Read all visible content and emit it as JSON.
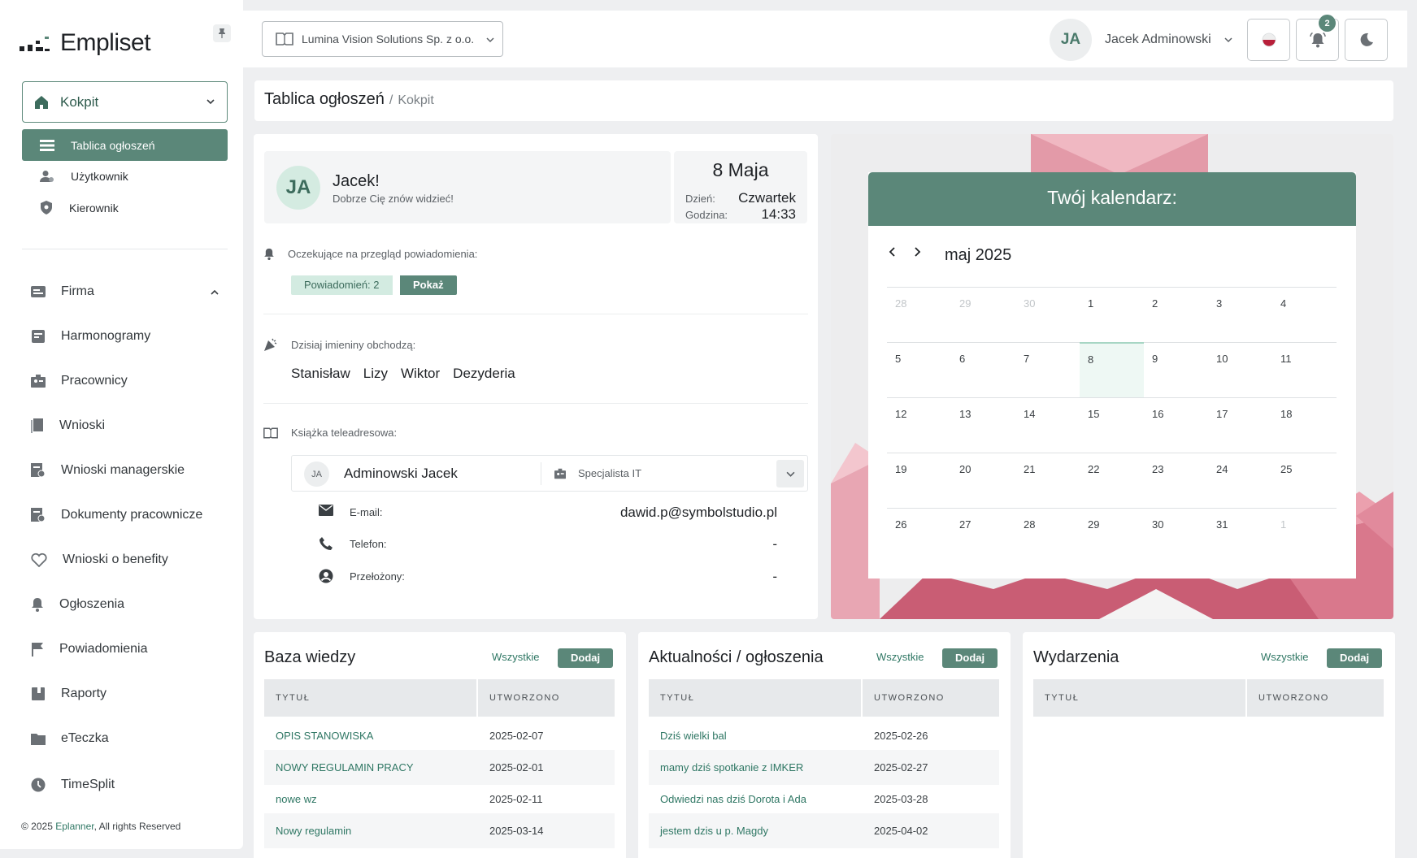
{
  "brand": {
    "name": "Empliset"
  },
  "sidebar": {
    "main_menu": {
      "label": "Kokpit"
    },
    "sub_items": [
      {
        "label": "Tablica ogłoszeń",
        "icon": "list-icon",
        "active": true
      },
      {
        "label": "Użytkownik",
        "icon": "user-icon",
        "active": false
      },
      {
        "label": "Kierownik",
        "icon": "shield-icon",
        "active": false
      }
    ],
    "nav_items": [
      {
        "label": "Firma",
        "icon": "company-icon",
        "expandable": true
      },
      {
        "label": "Harmonogramy",
        "icon": "schedule-icon"
      },
      {
        "label": "Pracownicy",
        "icon": "employees-icon"
      },
      {
        "label": "Wnioski",
        "icon": "requests-icon"
      },
      {
        "label": "Wnioski managerskie",
        "icon": "manager-requests-icon"
      },
      {
        "label": "Dokumenty pracownicze",
        "icon": "documents-icon"
      },
      {
        "label": "Wnioski o benefity",
        "icon": "benefits-icon"
      },
      {
        "label": "Ogłoszenia",
        "icon": "bell-icon"
      },
      {
        "label": "Powiadomienia",
        "icon": "flag-icon"
      },
      {
        "label": "Raporty",
        "icon": "reports-icon"
      },
      {
        "label": "eTeczka",
        "icon": "folder-icon"
      },
      {
        "label": "TimeSplit",
        "icon": "clock-icon"
      }
    ],
    "footer": {
      "prefix": "© 2025",
      "link": "Eplanner",
      "suffix": ", All rights Reserved"
    }
  },
  "topbar": {
    "company": "Lumina Vision Solutions Sp. z o.o.",
    "user_initials": "JA",
    "user_name": "Jacek Adminowski",
    "notifications_count": "2",
    "accent": "#5b8779"
  },
  "breadcrumb": {
    "title": "Tablica ogłoszeń",
    "separator": "/",
    "parent": "Kokpit"
  },
  "welcome": {
    "initials": "JA",
    "name": "Jacek!",
    "subtitle": "Dobrze Cię znów widzieć!",
    "date": "8 Maja",
    "day_label": "Dzień:",
    "day_value": "Czwartek",
    "time_label": "Godzina:",
    "time_value": "14:33",
    "pending_label": "Oczekujące na przegląd powiadomienia:",
    "pending_count": "Powiadomień: 2",
    "pending_show": "Pokaż",
    "nameday_label": "Dzisiaj imieniny obchodzą:",
    "nameday_names": [
      "Stanisław",
      "Lizy",
      "Wiktor",
      "Dezyderia"
    ],
    "addressbook_label": "Książka teleadresowa:",
    "contact": {
      "initials": "JA",
      "name": "Adminowski Jacek",
      "role": "Specjalista IT",
      "email_label": "E-mail:",
      "email": "dawid.p@symbolstudio.pl",
      "phone_label": "Telefon:",
      "phone": "-",
      "supervisor_label": "Przełożony:",
      "supervisor": "-"
    }
  },
  "calendar": {
    "title": "Twój kalendarz:",
    "month": "maj 2025",
    "weeks": [
      [
        {
          "d": "28",
          "m": true
        },
        {
          "d": "29",
          "m": true
        },
        {
          "d": "30",
          "m": true
        },
        {
          "d": "1"
        },
        {
          "d": "2"
        },
        {
          "d": "3"
        },
        {
          "d": "4"
        }
      ],
      [
        {
          "d": "5"
        },
        {
          "d": "6"
        },
        {
          "d": "7"
        },
        {
          "d": "8",
          "today": true
        },
        {
          "d": "9"
        },
        {
          "d": "10"
        },
        {
          "d": "11"
        }
      ],
      [
        {
          "d": "12"
        },
        {
          "d": "13"
        },
        {
          "d": "14"
        },
        {
          "d": "15"
        },
        {
          "d": "16"
        },
        {
          "d": "17"
        },
        {
          "d": "18"
        }
      ],
      [
        {
          "d": "19"
        },
        {
          "d": "20"
        },
        {
          "d": "21"
        },
        {
          "d": "22"
        },
        {
          "d": "23"
        },
        {
          "d": "24"
        },
        {
          "d": "25"
        }
      ],
      [
        {
          "d": "26"
        },
        {
          "d": "27"
        },
        {
          "d": "28"
        },
        {
          "d": "29"
        },
        {
          "d": "30"
        },
        {
          "d": "31"
        },
        {
          "d": "1",
          "m": true
        }
      ]
    ]
  },
  "knowledge": {
    "title": "Baza wiedzy",
    "all": "Wszystkie",
    "add": "Dodaj",
    "col_title": "TYTUŁ",
    "col_created": "UTWORZONO",
    "rows": [
      [
        "OPIS STANOWISKA",
        "2025-02-07"
      ],
      [
        "NOWY REGULAMIN PRACY",
        "2025-02-01"
      ],
      [
        "nowe wz",
        "2025-02-11"
      ],
      [
        "Nowy regulamin",
        "2025-03-14"
      ]
    ]
  },
  "news": {
    "title": "Aktualności / ogłoszenia",
    "all": "Wszystkie",
    "add": "Dodaj",
    "col_title": "TYTUŁ",
    "col_created": "UTWORZONO",
    "rows": [
      [
        "Dziś wielki bal",
        "2025-02-26"
      ],
      [
        "mamy dziś spotkanie z IMKER",
        "2025-02-27"
      ],
      [
        "Odwiedzi nas dziś Dorota i Ada",
        "2025-03-28"
      ],
      [
        "jestem dzis u p. Magdy",
        "2025-04-02"
      ]
    ]
  },
  "events": {
    "title": "Wydarzenia",
    "all": "Wszystkie",
    "add": "Dodaj",
    "col_title": "TYTUŁ",
    "col_created": "UTWORZONO",
    "rows": []
  }
}
